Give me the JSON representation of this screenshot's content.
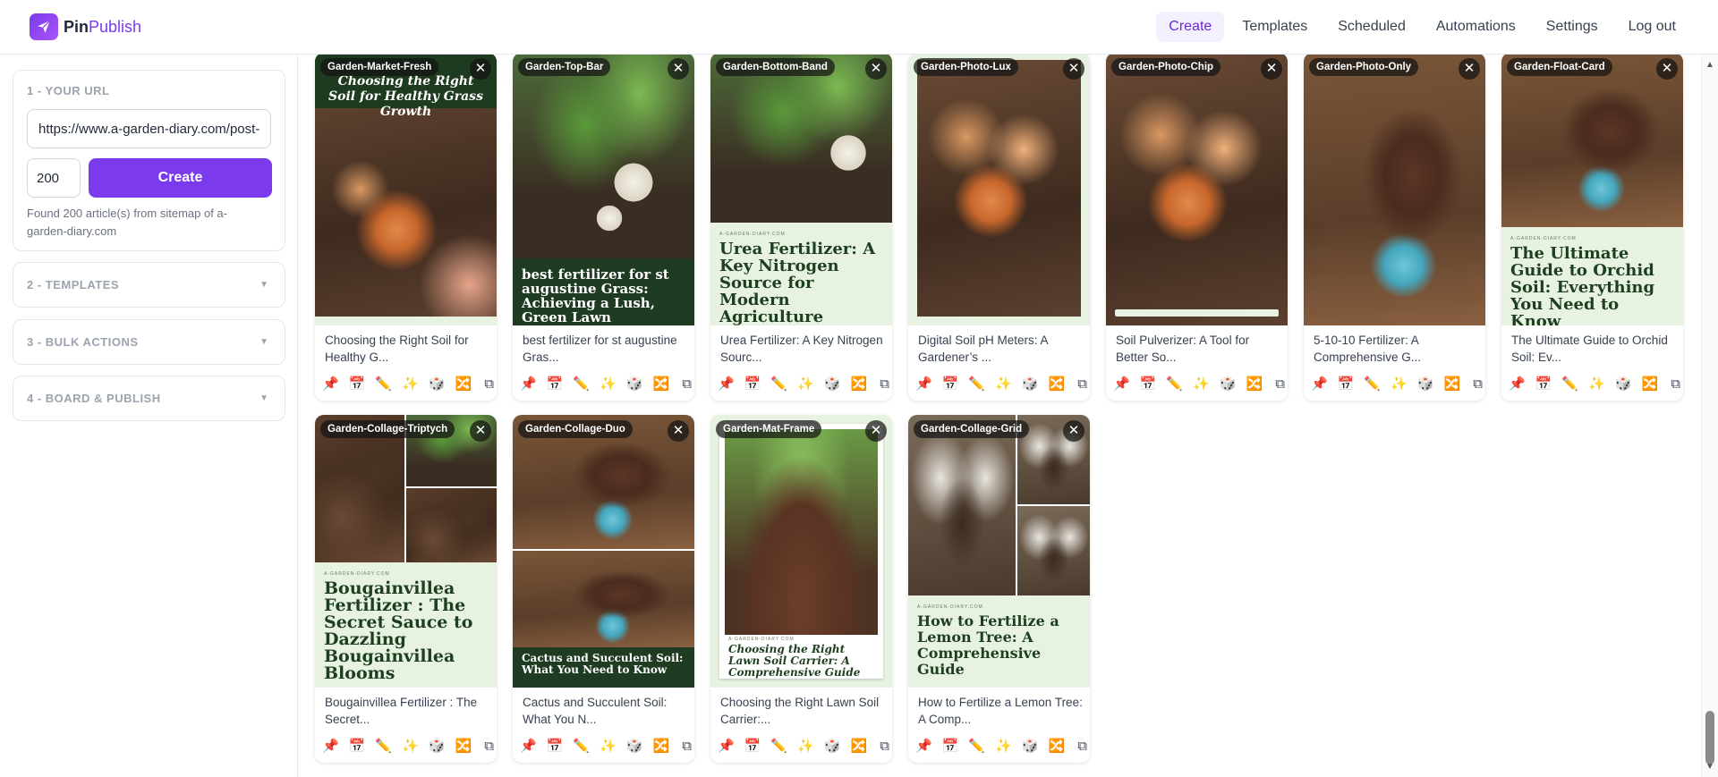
{
  "app": {
    "brand_bold": "Pin",
    "brand_accent": "Publish",
    "accent_color": "#7c3aed"
  },
  "nav": {
    "items": [
      {
        "label": "Create",
        "active": true
      },
      {
        "label": "Templates",
        "active": false
      },
      {
        "label": "Scheduled",
        "active": false
      },
      {
        "label": "Automations",
        "active": false
      },
      {
        "label": "Settings",
        "active": false
      },
      {
        "label": "Log out",
        "active": false
      }
    ]
  },
  "sidebar": {
    "url_panel": {
      "title": "1 - YOUR URL",
      "url_value": "https://www.a-garden-diary.com/post-sitemap.xml",
      "count_value": "200",
      "create_label": "Create",
      "found_text": "Found 200 article(s) from sitemap of a-garden-diary.com"
    },
    "templates_panel": {
      "title": "2 - TEMPLATES",
      "chevron": "▼"
    },
    "bulk_panel": {
      "title": "3 - BULK ACTIONS",
      "chevron": "▼"
    },
    "board_panel": {
      "title": "4 - BOARD & PUBLISH",
      "chevron": "▼"
    }
  },
  "card_actions": {
    "icons": [
      {
        "name": "pin-icon",
        "glyph": "📌"
      },
      {
        "name": "calendar-icon",
        "glyph": "📅"
      },
      {
        "name": "pencil-icon",
        "glyph": "✏️"
      },
      {
        "name": "sparkle-icon",
        "glyph": "✨"
      },
      {
        "name": "dice-icon",
        "glyph": "🎲"
      },
      {
        "name": "shuffle-icon",
        "glyph": "🔀"
      },
      {
        "name": "copy-icon",
        "glyph": "⧉"
      }
    ]
  },
  "close_glyph": "✕",
  "pins": [
    {
      "template": "Garden-Market-Fresh",
      "image_text": "Choosing the Right Soil for Healthy Grass Growth",
      "caption": "Choosing the Right Soil for Healthy G..."
    },
    {
      "template": "Garden-Top-Bar",
      "image_text": "best fertilizer for st augustine Grass: Achieving a Lush, Green Lawn",
      "caption": "best fertilizer for st augustine Gras..."
    },
    {
      "template": "Garden-Bottom-Band",
      "image_text": "Urea Fertilizer: A Key Nitrogen Source for Modern Agriculture",
      "caption": "Urea Fertilizer: A Key Nitrogen Sourc..."
    },
    {
      "template": "Garden-Photo-Lux",
      "image_text": "",
      "caption": "Digital Soil pH Meters: A Gardener’s ..."
    },
    {
      "template": "Garden-Photo-Chip",
      "image_text": "",
      "caption": "Soil Pulverizer: A Tool for Better So..."
    },
    {
      "template": "Garden-Photo-Only",
      "image_text": "",
      "caption": "5-10-10 Fertilizer: A Comprehensive G..."
    },
    {
      "template": "Garden-Float-Card",
      "image_text": "The Ultimate Guide to Orchid Soil: Everything You Need to Know",
      "caption": "The Ultimate Guide to Orchid Soil: Ev..."
    },
    {
      "template": "Garden-Collage-Triptych",
      "image_text": "Bougainvillea Fertilizer : The Secret Sauce to Dazzling Bougainvillea Blooms",
      "caption": "Bougainvillea Fertilizer : The Secret..."
    },
    {
      "template": "Garden-Collage-Duo",
      "image_text": "Cactus and Succulent Soil: What You Need to Know",
      "caption": "Cactus and Succulent Soil: What You N..."
    },
    {
      "template": "Garden-Mat-Frame",
      "image_text": "Choosing the Right Lawn Soil Carrier: A Comprehensive Guide",
      "caption": "Choosing the Right Lawn Soil Carrier:..."
    },
    {
      "template": "Garden-Collage-Grid",
      "image_text": "How to Fertilize a Lemon Tree: A Comprehensive Guide",
      "caption": "How to Fertilize a Lemon Tree: A Comp..."
    }
  ]
}
